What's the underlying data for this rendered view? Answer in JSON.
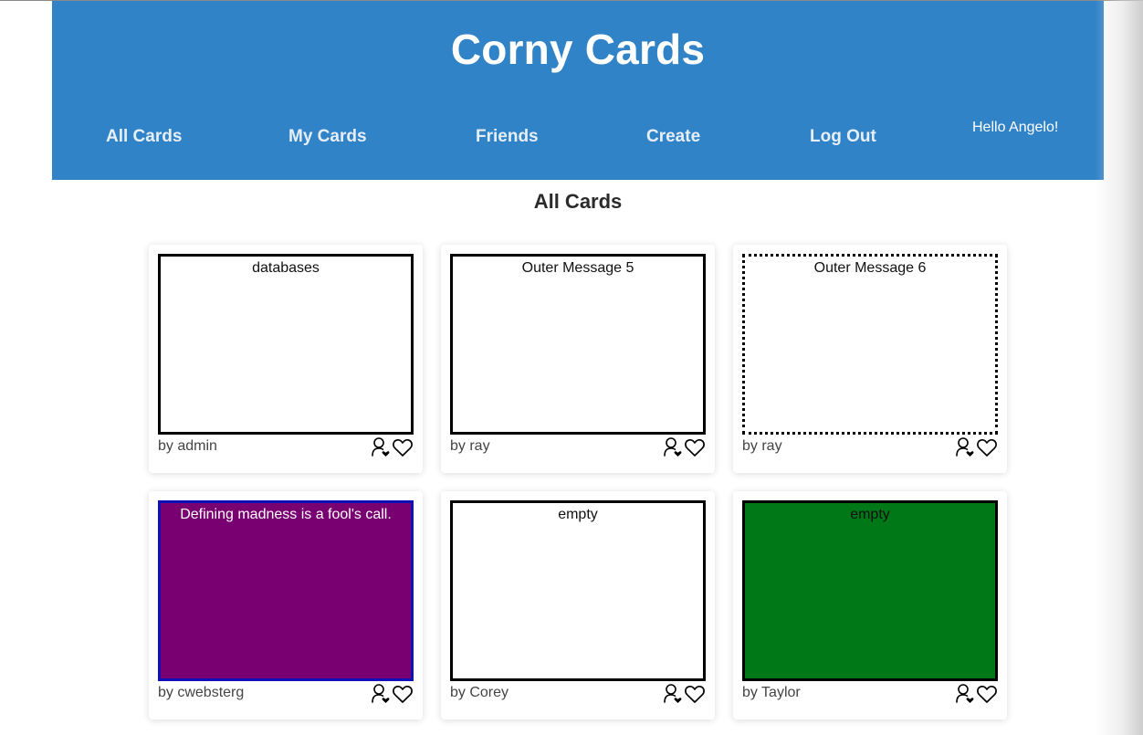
{
  "header": {
    "title": "Corny Cards",
    "greeting": "Hello Angelo!",
    "background_color": "#3183c8"
  },
  "nav": {
    "items": [
      {
        "label": "All Cards"
      },
      {
        "label": "My Cards"
      },
      {
        "label": "Friends"
      },
      {
        "label": "Create"
      },
      {
        "label": "Log Out"
      }
    ]
  },
  "main": {
    "section_title": "All Cards"
  },
  "cards": [
    {
      "message": "databases",
      "author": "by admin",
      "style": "solid",
      "background": "#ffffff",
      "border_color": "#000000"
    },
    {
      "message": "Outer Message 5",
      "author": "by ray",
      "style": "solid",
      "background": "#ffffff",
      "border_color": "#000000"
    },
    {
      "message": "Outer Message 6",
      "author": "by ray",
      "style": "dotted",
      "background": "#ffffff",
      "border_color": "#000000"
    },
    {
      "message": "Defining madness is a fool's call.",
      "author": "by cwebsterg",
      "style": "solid",
      "background": "#780070",
      "border_color": "#1010b8"
    },
    {
      "message": "empty",
      "author": "by Corey",
      "style": "solid",
      "background": "#ffffff",
      "border_color": "#000000"
    },
    {
      "message": "empty",
      "author": "by Taylor",
      "style": "solid",
      "background": "#017818",
      "border_color": "#000000"
    }
  ],
  "icons": {
    "follow": "user-heart-icon",
    "like": "heart-icon"
  }
}
